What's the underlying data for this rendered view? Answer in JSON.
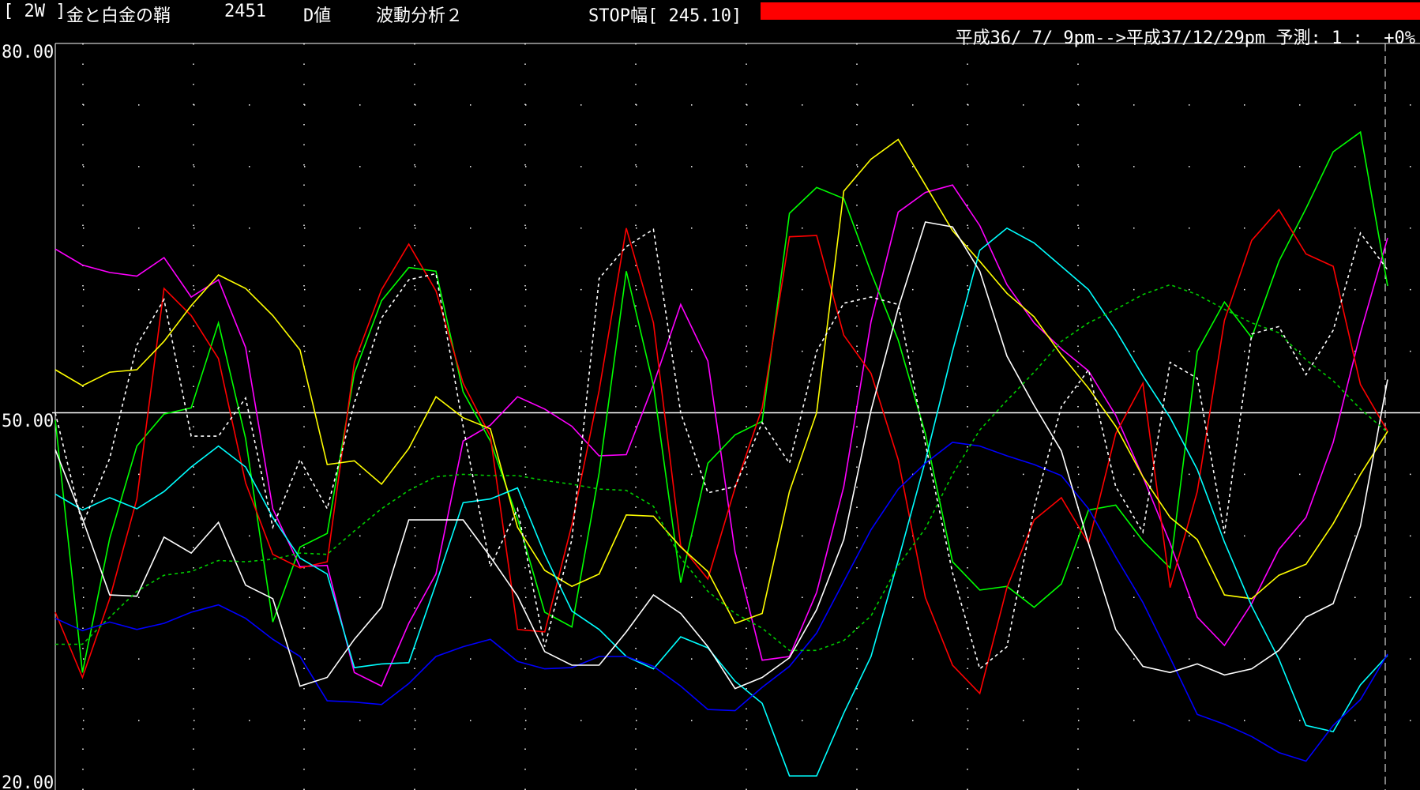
{
  "header": {
    "timeframe": "[ 2W ]",
    "instrument": "金と白金の鞘",
    "code": "2451",
    "value_type": "D値",
    "analysis": "波動分析２",
    "stop_width": "STOP幅[ 245.10]"
  },
  "subheader": {
    "period": "平成36/ 7/ 9pm-->平成37/12/29pm",
    "forecast": "予測: 1 :  +0%"
  },
  "colors": {
    "stop_bar": "#ff0000",
    "background": "#000000",
    "grid": "#ffffff"
  },
  "chart_data": {
    "type": "line",
    "ylim": [
      20,
      80
    ],
    "yticks": [
      "80.00",
      "50.00",
      "20.00"
    ],
    "reference_line": 50,
    "n_points": 50,
    "series": [
      {
        "color": "#ff00ff",
        "style": "solid",
        "values": [
          63.3,
          62,
          61.4,
          61.1,
          62.6,
          59.4,
          60.8,
          55.3,
          42.2,
          37.5,
          37.6,
          28.9,
          27.8,
          32.9,
          36.9,
          47.7,
          49,
          51.3,
          50.3,
          48.9,
          46.5,
          46.6,
          52.3,
          58.8,
          54.2,
          38.7,
          29.9,
          30.2,
          35.4,
          44,
          57.4,
          66.3,
          67.9,
          68.5,
          65.2,
          60.4,
          57.3,
          55.2,
          53.4,
          49.8,
          44.8,
          39.4,
          33.4,
          31.1,
          34.5,
          38.9,
          41.5,
          47.6,
          56.5,
          64.2
        ]
      },
      {
        "color": "#00ff00",
        "style": "solid",
        "values": [
          49.4,
          28.9,
          39.8,
          47.3,
          49.9,
          50.4,
          57.3,
          47.9,
          33,
          39.1,
          40.2,
          53.2,
          59.1,
          61.8,
          61.5,
          51.7,
          47.7,
          41.4,
          33.8,
          32.6,
          45.1,
          61.5,
          52.2,
          36.2,
          45.9,
          48.2,
          49.3,
          66.2,
          68.3,
          67.4,
          61.4,
          55.9,
          48.3,
          37.9,
          35.6,
          35.9,
          34.2,
          36.1,
          42.1,
          42.5,
          39.6,
          37.4,
          55,
          59,
          56.1,
          62.3,
          66.6,
          71.2,
          72.8,
          60.3
        ]
      },
      {
        "color": "#ff0000",
        "style": "solid",
        "values": [
          33.8,
          28.5,
          34.9,
          43,
          60.1,
          57.9,
          54.4,
          44.3,
          38.5,
          37.4,
          37.9,
          54.1,
          60,
          63.7,
          59.9,
          52.4,
          48.1,
          32.4,
          32.2,
          40.9,
          51.8,
          65,
          57.3,
          39.2,
          36.5,
          43.9,
          50.4,
          64.3,
          64.4,
          56.3,
          53.2,
          46.2,
          35,
          29.5,
          27.2,
          35.8,
          41.3,
          43.1,
          39.4,
          48.3,
          52.4,
          35.8,
          43.6,
          57.5,
          64,
          66.5,
          62.9,
          61.9,
          52.3,
          48.5
        ]
      },
      {
        "color": "#ffff00",
        "style": "solid",
        "values": [
          53.5,
          52.2,
          53.3,
          53.5,
          55.8,
          58.7,
          61.2,
          60.1,
          57.9,
          55.1,
          45.8,
          46.1,
          44.2,
          47.1,
          51.3,
          49.6,
          48.7,
          40.7,
          37.2,
          35.9,
          36.9,
          41.7,
          41.6,
          39.1,
          37.1,
          32.9,
          33.7,
          43.6,
          50,
          68,
          70.6,
          72.2,
          68.5,
          64.8,
          62.3,
          59.7,
          57.8,
          54.7,
          52,
          48.9,
          44.8,
          41.5,
          39.7,
          35.2,
          34.9,
          36.8,
          37.7,
          41,
          45,
          48.5
        ]
      },
      {
        "color": "#00ffff",
        "style": "solid",
        "values": [
          43.4,
          42.1,
          43.1,
          42.2,
          43.6,
          45.6,
          47.3,
          45.6,
          41.5,
          38.2,
          36.9,
          29.3,
          29.6,
          29.7,
          36.1,
          42.7,
          43,
          43.9,
          38.5,
          33.9,
          32.4,
          30.2,
          29.2,
          31.8,
          30.9,
          28.2,
          26.4,
          20.5,
          20.5,
          25.6,
          30.2,
          38,
          46.1,
          55,
          63.2,
          65,
          63.8,
          61.9,
          60,
          56.7,
          53,
          49.6,
          45.4,
          39.5,
          34.3,
          30,
          24.6,
          24.1,
          27.9,
          30.3
        ]
      },
      {
        "color": "#0000ff",
        "style": "solid",
        "values": [
          33.3,
          32.3,
          33,
          32.4,
          32.9,
          33.8,
          34.4,
          33.3,
          31.6,
          30.2,
          26.6,
          26.5,
          26.3,
          28,
          30.2,
          31,
          31.6,
          29.8,
          29.2,
          29.3,
          30.2,
          30.2,
          29.4,
          27.8,
          25.9,
          25.8,
          27.7,
          29.4,
          32.1,
          36.3,
          40.5,
          43.8,
          45.9,
          47.6,
          47.3,
          46.5,
          45.8,
          44.9,
          42.2,
          38.3,
          34.6,
          30.1,
          25.5,
          24.7,
          23.7,
          22.4,
          21.7,
          24.6,
          26.7,
          30.4
        ]
      },
      {
        "color": "#ffffff",
        "style": "solid",
        "values": [
          47,
          41.4,
          35.2,
          35.1,
          39.9,
          38.6,
          41.1,
          36,
          34.9,
          27.8,
          28.5,
          31.6,
          34.2,
          41.3,
          41.3,
          41.3,
          38.3,
          35.1,
          30.6,
          29.5,
          29.5,
          32.2,
          35.2,
          33.7,
          31,
          27.6,
          28.5,
          30.1,
          34,
          39.7,
          50.2,
          58.5,
          65.5,
          65.1,
          61.5,
          54.6,
          50.6,
          46.9,
          39.4,
          32.4,
          29.4,
          28.9,
          29.6,
          28.7,
          29.2,
          30.7,
          33.4,
          34.5,
          40.8,
          52.7
        ]
      },
      {
        "color": "#ffffff",
        "style": "dashed",
        "values": [
          50,
          40.9,
          46.3,
          55.5,
          59.2,
          48.1,
          48.1,
          51.2,
          40.7,
          46.2,
          42.2,
          50.8,
          57.7,
          60.8,
          61.3,
          48.9,
          37.5,
          42.2,
          31,
          39.7,
          60.9,
          63.5,
          64.9,
          50,
          43.5,
          44,
          49.2,
          45.9,
          55,
          58.9,
          59.4,
          58.8,
          47.5,
          37,
          29.2,
          31,
          42.3,
          50.5,
          53.5,
          44,
          40.3,
          54.1,
          52.8,
          40.2,
          56.4,
          57,
          53.1,
          56.7,
          64.6,
          61.6
        ]
      },
      {
        "color": "#00cc00",
        "style": "dashed",
        "values": [
          31.2,
          31.2,
          33.4,
          35.5,
          36.8,
          37.1,
          38,
          37.9,
          38.1,
          38.6,
          38.5,
          40.4,
          42.2,
          43.7,
          44.8,
          45,
          44.9,
          44.9,
          44.5,
          44.2,
          43.8,
          43.7,
          42.4,
          38.2,
          35.5,
          33.7,
          32.5,
          30.7,
          30.7,
          31.5,
          33.5,
          37.6,
          40.6,
          45,
          48.6,
          51,
          53.3,
          55.8,
          57.3,
          58.4,
          59.6,
          60.4,
          59.6,
          58.4,
          57.3,
          56.5,
          54.3,
          52.6,
          50.3,
          48.4
        ]
      }
    ]
  }
}
